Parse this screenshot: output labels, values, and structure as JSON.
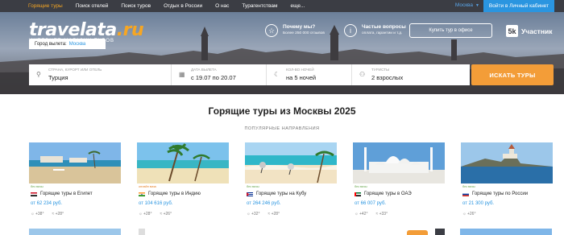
{
  "topnav": {
    "items": [
      "Горящие туры",
      "Поиск отелей",
      "Поиск туров",
      "Отдых в России",
      "О нас",
      "Турагентствам",
      "еще..."
    ],
    "city": "Москва",
    "cabinet": "Войти в Личный кабинет"
  },
  "hero": {
    "logo_main": "travelata",
    "logo_ru": ".ru",
    "logo_sub": "ИНТЕРНЕТ-МАГАЗИН ТУРОВ",
    "features": [
      {
        "icon": "star-icon",
        "title": "Почему мы?",
        "sub": "Более 250 000 отзывов"
      },
      {
        "icon": "info-icon",
        "title": "Частые вопросы",
        "sub": "оплата, гарантии и т.д."
      }
    ],
    "office_button": "Купить тур в офисе",
    "participant_badge": "5k",
    "participant_label": "Участник"
  },
  "search": {
    "depart_label": "Город вылета:",
    "depart_city": "Москва",
    "fields": [
      {
        "label": "Страна, курорт или отель",
        "value": "Турция",
        "icon": "location-pin-icon"
      },
      {
        "label": "Дата вылета",
        "value": "с 19.07 по 20.07",
        "icon": "calendar-icon"
      },
      {
        "label": "Кол-во ночей",
        "value": "на 5 ночей",
        "icon": "moon-icon"
      },
      {
        "label": "Туристы",
        "value": "2 взрослых",
        "icon": "user-icon"
      }
    ],
    "button": "ИСКАТЬ ТУРЫ"
  },
  "main": {
    "title": "Горящие туры из Москвы 2025",
    "subtitle": "ПОПУЛЯРНЫЕ НАПРАВЛЕНИЯ"
  },
  "cards": [
    {
      "tag": "без визы",
      "title": "Горящие туры в Египет",
      "price": "от 62 234 руб.",
      "temps": [
        "+38°",
        "+28°"
      ],
      "flag": "egypt"
    },
    {
      "tag": "онлайн виза",
      "title": "Горящие туры в Индию",
      "price": "от 104 616 руб.",
      "temps": [
        "+28°",
        "+26°"
      ],
      "flag": "india"
    },
    {
      "tag": "без визы",
      "title": "Горящие туры на Кубу",
      "price": "от 264 246 руб.",
      "temps": [
        "+32°",
        "+28°"
      ],
      "flag": "cuba"
    },
    {
      "tag": "без визы",
      "title": "Горящие туры в ОАЭ",
      "price": "от 66 007 руб.",
      "temps": [
        "+42°",
        "+33°"
      ],
      "flag": "uae"
    },
    {
      "tag": "без визы",
      "title": "Горящие туры по России",
      "price": "от 21 300 руб.",
      "temps": [
        "+26°"
      ],
      "flag": "russia"
    }
  ],
  "colors": {
    "accent": "#f39d38",
    "link": "#2a95e0",
    "nav_bg": "#3b3d44"
  }
}
